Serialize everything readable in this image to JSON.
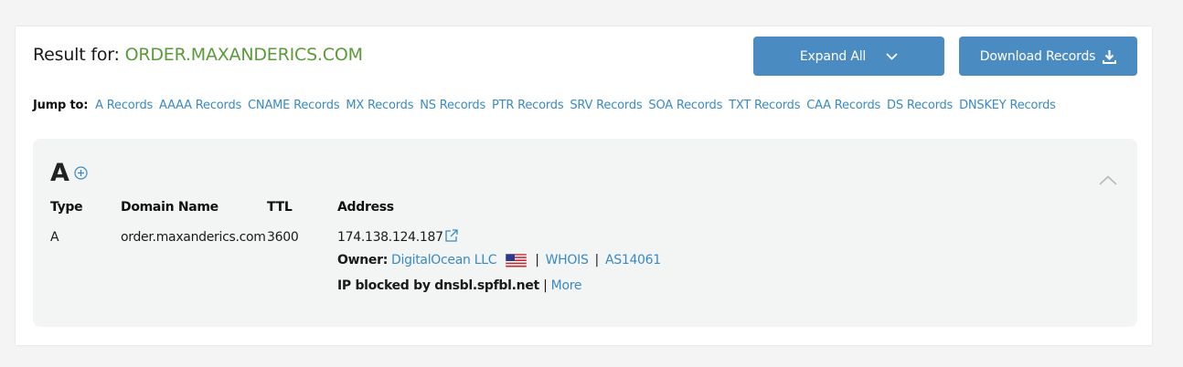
{
  "header": {
    "result_prefix": "Result for:",
    "domain": "ORDER.MAXANDERICS.COM",
    "expand_label": "Expand All",
    "download_label": "Download Records"
  },
  "jump": {
    "label": "Jump to:",
    "links": [
      "A Records",
      "AAAA Records",
      "CNAME Records",
      "MX Records",
      "NS Records",
      "PTR Records",
      "SRV Records",
      "SOA Records",
      "TXT Records",
      "CAA Records",
      "DS Records",
      "DNSKEY Records"
    ]
  },
  "section": {
    "letter": "A",
    "columns": {
      "type": "Type",
      "domain": "Domain Name",
      "ttl": "TTL",
      "address": "Address"
    },
    "row": {
      "type": "A",
      "domain": "order.maxanderics.com",
      "ttl": "3600",
      "address": "174.138.124.187"
    },
    "owner": {
      "label": "Owner:",
      "name": "DigitalOcean LLC",
      "whois": "WHOIS",
      "asn": "AS14061",
      "separator": "|"
    },
    "blocked": {
      "text": "IP blocked by dnsbl.spfbl.net",
      "separator": "|",
      "more": "More"
    }
  },
  "colors": {
    "domain_green": "#5a9a3a",
    "button_blue": "#4a8bc2",
    "link_blue": "#3a8ac4",
    "panel_bg": "#f3f4f4"
  },
  "icons": {
    "expand": "chevron-down-icon",
    "download": "download-icon",
    "add": "plus-circle-icon",
    "collapse": "chevron-up-icon",
    "external": "external-link-icon",
    "flag": "us-flag-icon"
  }
}
